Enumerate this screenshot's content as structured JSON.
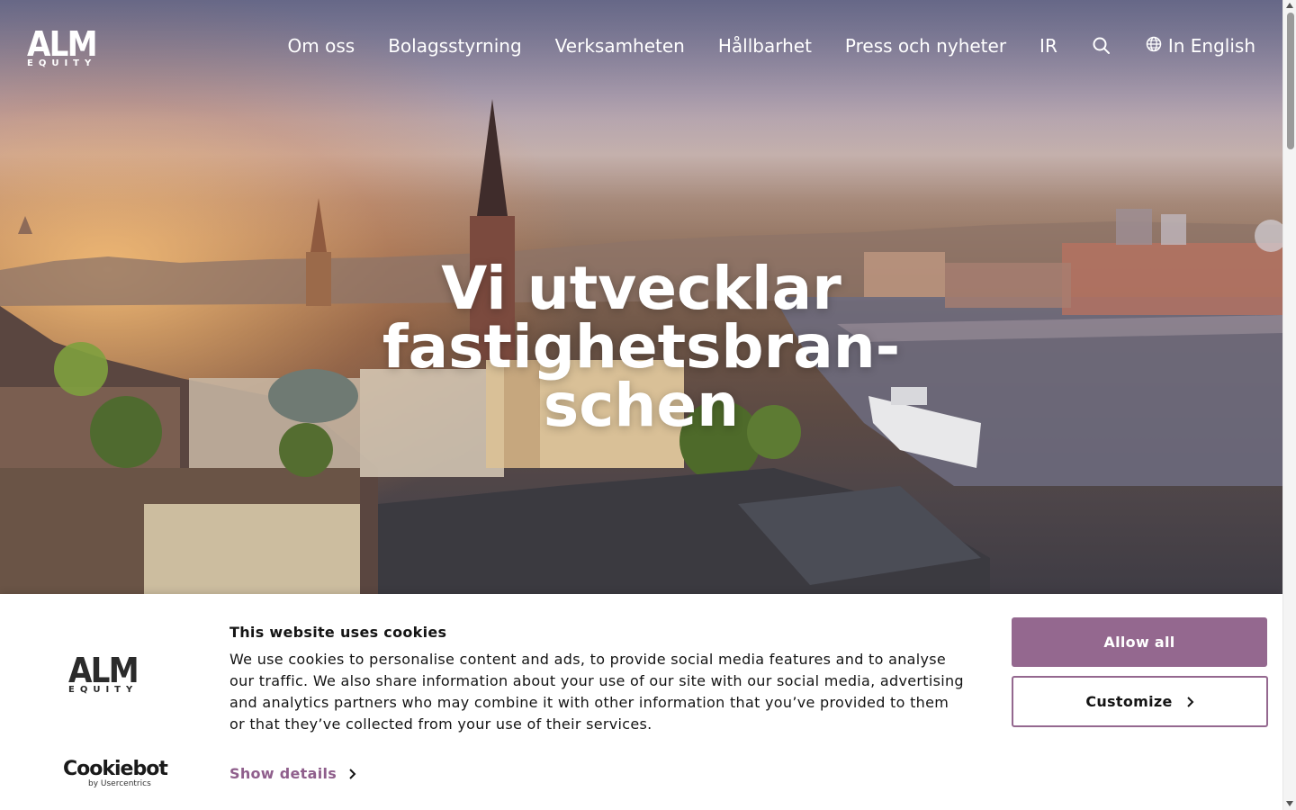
{
  "header": {
    "logo": {
      "main": "ALM",
      "sub": "EQUITY"
    },
    "nav": [
      {
        "label": "Om oss"
      },
      {
        "label": "Bolagsstyrning"
      },
      {
        "label": "Verksamheten"
      },
      {
        "label": "Hållbarhet"
      },
      {
        "label": "Press och nyheter"
      },
      {
        "label": "IR"
      }
    ],
    "search_icon": "search-icon",
    "language": {
      "icon": "globe-icon",
      "label": "In English"
    }
  },
  "hero": {
    "title_lines": [
      "Vi utvecklar",
      "fastighetsbran-",
      "schen"
    ]
  },
  "cookie_banner": {
    "logo": {
      "main": "ALM",
      "sub": "EQUITY"
    },
    "title": "This website uses cookies",
    "text": "We use cookies to personalise content and ads, to provide social media features and to analyse our traffic. We also share information about your use of our site with our social media, advertising and analytics partners who may combine it with other information that you’ve provided to them or that they’ve collected from your use of their services.",
    "show_details": "Show details",
    "allow_all": "Allow all",
    "customize": "Customize",
    "provider": {
      "brand": "Cookiebot",
      "by": "by Usercentrics"
    }
  },
  "colors": {
    "accent": "#94688f",
    "accent_text": "#8f5f8c",
    "text": "#141414"
  }
}
